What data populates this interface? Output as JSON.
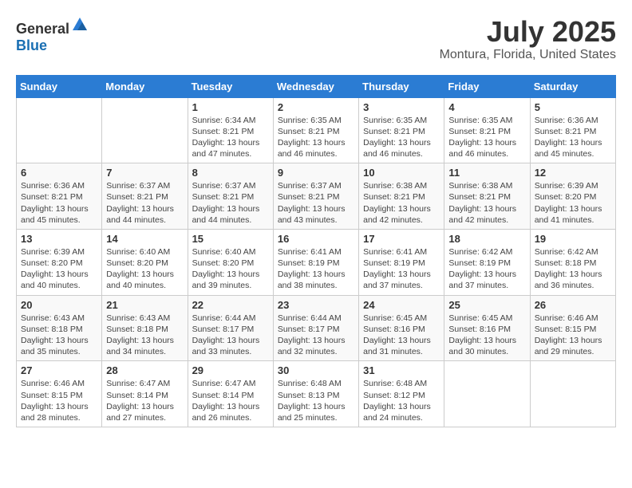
{
  "header": {
    "logo_general": "General",
    "logo_blue": "Blue",
    "title": "July 2025",
    "subtitle": "Montura, Florida, United States"
  },
  "calendar": {
    "days_of_week": [
      "Sunday",
      "Monday",
      "Tuesday",
      "Wednesday",
      "Thursday",
      "Friday",
      "Saturday"
    ],
    "weeks": [
      [
        {
          "day": "",
          "sunrise": "",
          "sunset": "",
          "daylight": ""
        },
        {
          "day": "",
          "sunrise": "",
          "sunset": "",
          "daylight": ""
        },
        {
          "day": "1",
          "sunrise": "Sunrise: 6:34 AM",
          "sunset": "Sunset: 8:21 PM",
          "daylight": "Daylight: 13 hours and 47 minutes."
        },
        {
          "day": "2",
          "sunrise": "Sunrise: 6:35 AM",
          "sunset": "Sunset: 8:21 PM",
          "daylight": "Daylight: 13 hours and 46 minutes."
        },
        {
          "day": "3",
          "sunrise": "Sunrise: 6:35 AM",
          "sunset": "Sunset: 8:21 PM",
          "daylight": "Daylight: 13 hours and 46 minutes."
        },
        {
          "day": "4",
          "sunrise": "Sunrise: 6:35 AM",
          "sunset": "Sunset: 8:21 PM",
          "daylight": "Daylight: 13 hours and 46 minutes."
        },
        {
          "day": "5",
          "sunrise": "Sunrise: 6:36 AM",
          "sunset": "Sunset: 8:21 PM",
          "daylight": "Daylight: 13 hours and 45 minutes."
        }
      ],
      [
        {
          "day": "6",
          "sunrise": "Sunrise: 6:36 AM",
          "sunset": "Sunset: 8:21 PM",
          "daylight": "Daylight: 13 hours and 45 minutes."
        },
        {
          "day": "7",
          "sunrise": "Sunrise: 6:37 AM",
          "sunset": "Sunset: 8:21 PM",
          "daylight": "Daylight: 13 hours and 44 minutes."
        },
        {
          "day": "8",
          "sunrise": "Sunrise: 6:37 AM",
          "sunset": "Sunset: 8:21 PM",
          "daylight": "Daylight: 13 hours and 44 minutes."
        },
        {
          "day": "9",
          "sunrise": "Sunrise: 6:37 AM",
          "sunset": "Sunset: 8:21 PM",
          "daylight": "Daylight: 13 hours and 43 minutes."
        },
        {
          "day": "10",
          "sunrise": "Sunrise: 6:38 AM",
          "sunset": "Sunset: 8:21 PM",
          "daylight": "Daylight: 13 hours and 42 minutes."
        },
        {
          "day": "11",
          "sunrise": "Sunrise: 6:38 AM",
          "sunset": "Sunset: 8:21 PM",
          "daylight": "Daylight: 13 hours and 42 minutes."
        },
        {
          "day": "12",
          "sunrise": "Sunrise: 6:39 AM",
          "sunset": "Sunset: 8:20 PM",
          "daylight": "Daylight: 13 hours and 41 minutes."
        }
      ],
      [
        {
          "day": "13",
          "sunrise": "Sunrise: 6:39 AM",
          "sunset": "Sunset: 8:20 PM",
          "daylight": "Daylight: 13 hours and 40 minutes."
        },
        {
          "day": "14",
          "sunrise": "Sunrise: 6:40 AM",
          "sunset": "Sunset: 8:20 PM",
          "daylight": "Daylight: 13 hours and 40 minutes."
        },
        {
          "day": "15",
          "sunrise": "Sunrise: 6:40 AM",
          "sunset": "Sunset: 8:20 PM",
          "daylight": "Daylight: 13 hours and 39 minutes."
        },
        {
          "day": "16",
          "sunrise": "Sunrise: 6:41 AM",
          "sunset": "Sunset: 8:19 PM",
          "daylight": "Daylight: 13 hours and 38 minutes."
        },
        {
          "day": "17",
          "sunrise": "Sunrise: 6:41 AM",
          "sunset": "Sunset: 8:19 PM",
          "daylight": "Daylight: 13 hours and 37 minutes."
        },
        {
          "day": "18",
          "sunrise": "Sunrise: 6:42 AM",
          "sunset": "Sunset: 8:19 PM",
          "daylight": "Daylight: 13 hours and 37 minutes."
        },
        {
          "day": "19",
          "sunrise": "Sunrise: 6:42 AM",
          "sunset": "Sunset: 8:18 PM",
          "daylight": "Daylight: 13 hours and 36 minutes."
        }
      ],
      [
        {
          "day": "20",
          "sunrise": "Sunrise: 6:43 AM",
          "sunset": "Sunset: 8:18 PM",
          "daylight": "Daylight: 13 hours and 35 minutes."
        },
        {
          "day": "21",
          "sunrise": "Sunrise: 6:43 AM",
          "sunset": "Sunset: 8:18 PM",
          "daylight": "Daylight: 13 hours and 34 minutes."
        },
        {
          "day": "22",
          "sunrise": "Sunrise: 6:44 AM",
          "sunset": "Sunset: 8:17 PM",
          "daylight": "Daylight: 13 hours and 33 minutes."
        },
        {
          "day": "23",
          "sunrise": "Sunrise: 6:44 AM",
          "sunset": "Sunset: 8:17 PM",
          "daylight": "Daylight: 13 hours and 32 minutes."
        },
        {
          "day": "24",
          "sunrise": "Sunrise: 6:45 AM",
          "sunset": "Sunset: 8:16 PM",
          "daylight": "Daylight: 13 hours and 31 minutes."
        },
        {
          "day": "25",
          "sunrise": "Sunrise: 6:45 AM",
          "sunset": "Sunset: 8:16 PM",
          "daylight": "Daylight: 13 hours and 30 minutes."
        },
        {
          "day": "26",
          "sunrise": "Sunrise: 6:46 AM",
          "sunset": "Sunset: 8:15 PM",
          "daylight": "Daylight: 13 hours and 29 minutes."
        }
      ],
      [
        {
          "day": "27",
          "sunrise": "Sunrise: 6:46 AM",
          "sunset": "Sunset: 8:15 PM",
          "daylight": "Daylight: 13 hours and 28 minutes."
        },
        {
          "day": "28",
          "sunrise": "Sunrise: 6:47 AM",
          "sunset": "Sunset: 8:14 PM",
          "daylight": "Daylight: 13 hours and 27 minutes."
        },
        {
          "day": "29",
          "sunrise": "Sunrise: 6:47 AM",
          "sunset": "Sunset: 8:14 PM",
          "daylight": "Daylight: 13 hours and 26 minutes."
        },
        {
          "day": "30",
          "sunrise": "Sunrise: 6:48 AM",
          "sunset": "Sunset: 8:13 PM",
          "daylight": "Daylight: 13 hours and 25 minutes."
        },
        {
          "day": "31",
          "sunrise": "Sunrise: 6:48 AM",
          "sunset": "Sunset: 8:12 PM",
          "daylight": "Daylight: 13 hours and 24 minutes."
        },
        {
          "day": "",
          "sunrise": "",
          "sunset": "",
          "daylight": ""
        },
        {
          "day": "",
          "sunrise": "",
          "sunset": "",
          "daylight": ""
        }
      ]
    ]
  }
}
